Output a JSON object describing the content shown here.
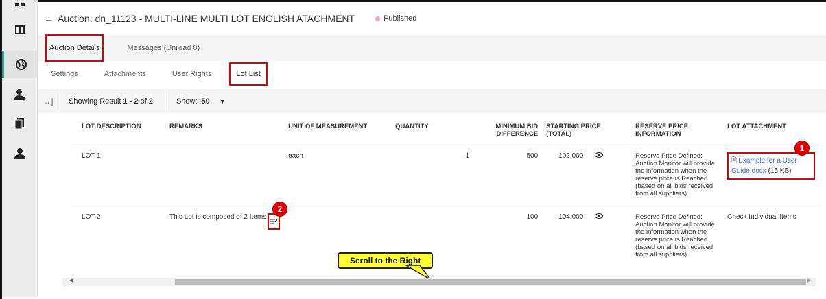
{
  "header": {
    "back_icon": "back-arrow-icon",
    "title": "Auction: dn_11123 - MULTI-LINE MULTI LOT ENGLISH ATACHMENT",
    "status": "Published",
    "status_color": "#f4a3c5"
  },
  "rail": {
    "icons": [
      "grid-icon",
      "layout-icon",
      "globe-icon",
      "user-settings-icon",
      "documents-icon",
      "user-icon"
    ],
    "active_color": "#2aa89a"
  },
  "main_tabs": [
    {
      "label": "Auction Details",
      "active": true
    },
    {
      "label": "Messages (Unread 0)",
      "active": false
    }
  ],
  "sub_tabs": [
    {
      "label": "Settings",
      "active": false
    },
    {
      "label": "Attachments",
      "active": false
    },
    {
      "label": "User Rights",
      "active": false
    },
    {
      "label": "Lot List",
      "active": true
    }
  ],
  "results": {
    "collapse_icon": "collapse-right-icon",
    "showing_prefix": "Showing Result",
    "range": "1 - 2",
    "of_text": "of",
    "total": "2",
    "show_label": "Show:",
    "show_value": "50"
  },
  "table": {
    "headers": {
      "desc": "LOT DESCRIPTION",
      "remarks": "REMARKS",
      "uom": "UNIT OF MEASUREMENT",
      "qty": "QUANTITY",
      "min_bid_1": "MINIMUM BID",
      "min_bid_2": "DIFFERENCE",
      "start": "STARTING PRICE (TOTAL)",
      "reserve_1": "RESERVE PRICE",
      "reserve_2": "INFORMATION",
      "attach": "LOT ATTACHMENT"
    },
    "rows": [
      {
        "desc": "LOT 1",
        "remarks": "",
        "uom": "each",
        "qty": "1",
        "min_bid": "500",
        "start": "102,000",
        "reserve": "Reserve Price Defined: Auction Monitor will provide the information when the reserve price is Reached (based on all bids received from all suppliers)",
        "attach_link": "Example for a User Guide.docx",
        "attach_size": "(15 KB)"
      },
      {
        "desc": "LOT 2",
        "remarks": "This Lot is composed of 2 Items",
        "uom": "",
        "qty": "",
        "min_bid": "100",
        "start": "104,000",
        "reserve": "Reserve Price Defined: Auction Monitor will provide the information when the reserve price is Reached (based on all bids received from all suppliers)",
        "attach_text": "Check Individual Items"
      }
    ]
  },
  "annotations": {
    "badge1": "1",
    "badge2": "2",
    "callout": "Scroll to the Right",
    "highlight_color": "#e00000",
    "callout_color": "#ffff33"
  }
}
